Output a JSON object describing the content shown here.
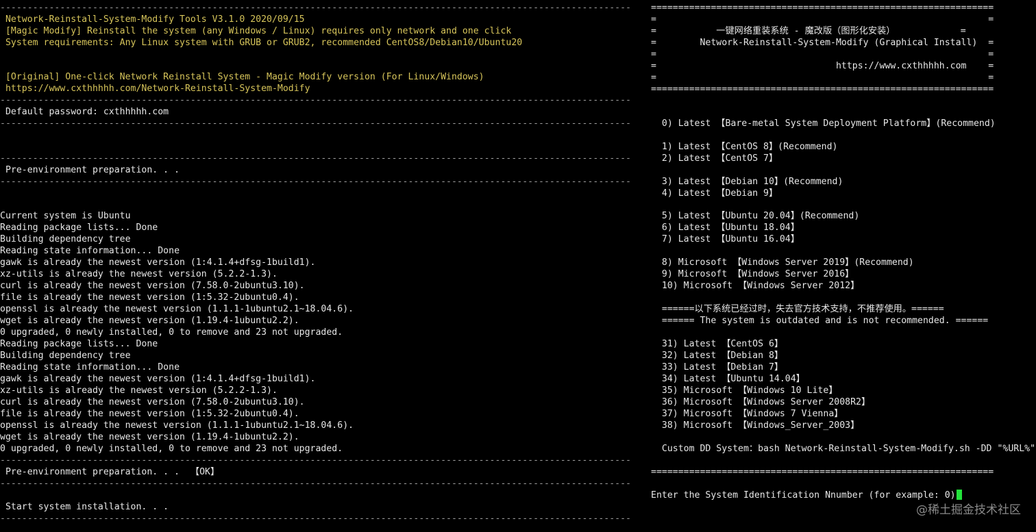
{
  "left_pane": {
    "lines": [
      "--------------------------------------------------------------------------------------------------------------------",
      " Network-Reinstall-System-Modify Tools V3.1.0 2020/09/15",
      " [Magic Modify] Reinstall the system (any Windows / Linux) requires only network and one click",
      " System requirements: Any Linux system with GRUB or GRUB2, recommended CentOS8/Debian10/Ubuntu20",
      "",
      "",
      " [Original] One-click Network Reinstall System - Magic Modify version (For Linux/Windows)",
      " https://www.cxthhhhh.com/Network-Reinstall-System-Modify",
      "--------------------------------------------------------------------------------------------------------------------",
      " Default password: cxthhhhh.com",
      "--------------------------------------------------------------------------------------------------------------------",
      "",
      "",
      "--------------------------------------------------------------------------------------------------------------------",
      " Pre-environment preparation. . .",
      "--------------------------------------------------------------------------------------------------------------------",
      "",
      "",
      "Current system is Ubuntu",
      "Reading package lists... Done",
      "Building dependency tree",
      "Reading state information... Done",
      "gawk is already the newest version (1:4.1.4+dfsg-1build1).",
      "xz-utils is already the newest version (5.2.2-1.3).",
      "curl is already the newest version (7.58.0-2ubuntu3.10).",
      "file is already the newest version (1:5.32-2ubuntu0.4).",
      "openssl is already the newest version (1.1.1-1ubuntu2.1~18.04.6).",
      "wget is already the newest version (1.19.4-1ubuntu2.2).",
      "0 upgraded, 0 newly installed, 0 to remove and 23 not upgraded.",
      "Reading package lists... Done",
      "Building dependency tree",
      "Reading state information... Done",
      "gawk is already the newest version (1:4.1.4+dfsg-1build1).",
      "xz-utils is already the newest version (5.2.2-1.3).",
      "curl is already the newest version (7.58.0-2ubuntu3.10).",
      "file is already the newest version (1:5.32-2ubuntu0.4).",
      "openssl is already the newest version (1.1.1-1ubuntu2.1~18.04.6).",
      "wget is already the newest version (1.19.4-1ubuntu2.2).",
      "0 upgraded, 0 newly installed, 0 to remove and 23 not upgraded.",
      "--------------------------------------------------------------------------------------------------------------------",
      " Pre-environment preparation. . .  【OK】",
      "--------------------------------------------------------------------------------------------------------------------",
      "",
      " Start system installation. . .",
      "--------------------------------------------------------------------------------------------------------------------"
    ]
  },
  "right_pane": {
    "lines": [
      "===============================================================",
      "=                                                             =",
      "=           一键网络重装系统 - 魔改版（图形化安装）            =",
      "=        Network-Reinstall-System-Modify (Graphical Install)  =",
      "=                                                             =",
      "=                                 https://www.cxthhhhh.com    =",
      "=                                                             =",
      "===============================================================",
      "",
      "",
      "  0) Latest 【Bare-metal System Deployment Platform】(Recommend)",
      "",
      "  1) Latest 【CentOS 8】(Recommend)",
      "  2) Latest 【CentOS 7】",
      "",
      "  3) Latest 【Debian 10】(Recommend)",
      "  4) Latest 【Debian 9】",
      "",
      "  5) Latest 【Ubuntu 20.04】(Recommend)",
      "  6) Latest 【Ubuntu 18.04】",
      "  7) Latest 【Ubuntu 16.04】",
      "",
      "  8) Microsoft 【Windows Server 2019】(Recommend)",
      "  9) Microsoft 【Windows Server 2016】",
      "  10) Microsoft 【Windows Server 2012】",
      "",
      "  ======以下系统已经过时，失去官方技术支持，不推荐使用。======",
      "  ====== The system is outdated and is not recommended. ======",
      "",
      "  31) Latest 【CentOS 6】",
      "  32) Latest 【Debian 8】",
      "  33) Latest 【Debian 7】",
      "  34) Latest 【Ubuntu 14.04】",
      "  35) Microsoft 【Windows 10 Lite】",
      "  36) Microsoft 【Windows Server 2008R2】",
      "  37) Microsoft 【Windows 7 Vienna】",
      "  38) Microsoft 【Windows_Server_2003】",
      "",
      "  Custom DD System：bash Network-Reinstall-System-Modify.sh -DD \"%URL%\"",
      "",
      "===============================================================",
      "",
      "Enter the System Identification Nnumber (for example: 0)"
    ]
  },
  "watermark": "@稀土掘金技术社区",
  "colors": {
    "background": "#000000",
    "text": "#e6e6e6",
    "highlight": "#d6c45a",
    "separator": "#9a9a9a",
    "cursor": "#22e23a"
  }
}
